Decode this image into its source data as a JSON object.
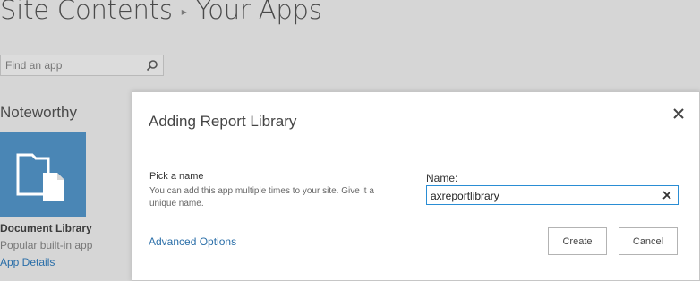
{
  "page": {
    "breadcrumb_site": "Site Contents",
    "breadcrumb_separator": "▸",
    "breadcrumb_current": "Your Apps",
    "search_placeholder": "Find an app"
  },
  "noteworthy": {
    "title": "Noteworthy",
    "tile": {
      "name": "Document Library",
      "description": "Popular built-in app",
      "details_link": "App Details",
      "color": "#4a86b5"
    }
  },
  "dialog": {
    "title": "Adding Report Library",
    "pick_label": "Pick a name",
    "pick_help": "You can add this app multiple times to your site. Give it a unique name.",
    "name_label": "Name:",
    "name_value": "axreportlibrary",
    "advanced_link": "Advanced Options",
    "create_label": "Create",
    "cancel_label": "Cancel",
    "accent": "#2a8dd4"
  }
}
